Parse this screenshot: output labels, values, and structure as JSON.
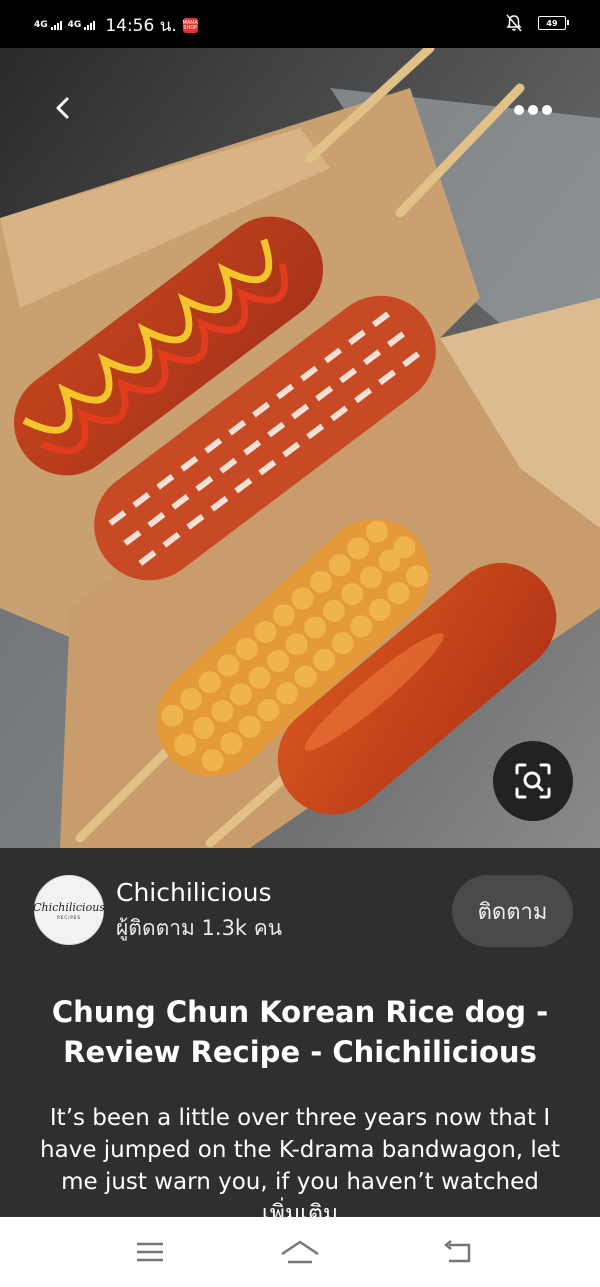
{
  "status_bar": {
    "network_1": "4G",
    "network_2": "4G",
    "time": "14:56 น.",
    "app_badge": "MAMA SHOP",
    "battery": "49",
    "icons": [
      "signal-icon",
      "signal-icon",
      "app-notification-icon",
      "mute-notifications-icon",
      "battery-icon"
    ]
  },
  "toolbar": {
    "back_icon": "chevron-left-icon",
    "more_icon": "more-horizontal-icon",
    "visual_search_icon": "lens-search-icon"
  },
  "creator": {
    "avatar_text": "Chichilicious",
    "avatar_subtext": "RECIPES",
    "name": "Chichilicious",
    "followers": "ผู้ติดตาม 1.3k คน",
    "follow_label": "ติดตาม"
  },
  "pin": {
    "title": "Chung Chun Korean Rice dog - Review Recipe - Chichilicious",
    "description": "It’s been a little over three years now that I have jumped on the K-drama bandwagon, let me just warn you, if you haven’t watched",
    "more_label": "เพิ่มเติม"
  },
  "nav_bar": {
    "icons": [
      "menu-icon",
      "home-icon",
      "back-icon"
    ]
  },
  "colors": {
    "panel_bg": "#2f2f2f",
    "follow_btn_bg": "#4a4a4a",
    "navbar_bg": "#ffffff"
  }
}
